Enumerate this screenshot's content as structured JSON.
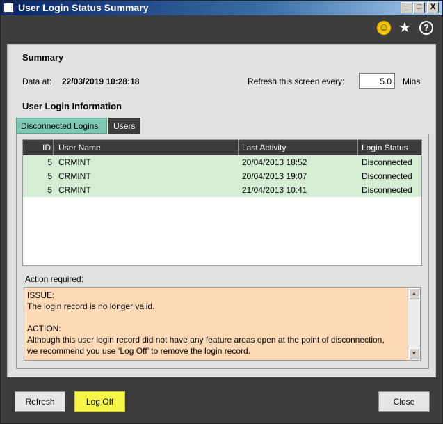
{
  "window": {
    "title": "User Login Status Summary",
    "controls": {
      "minimize": "_",
      "maximize": "□",
      "close": "X"
    }
  },
  "toolbar": {
    "icons": [
      "smiley-icon",
      "star-icon",
      "help-icon"
    ],
    "smiley": "☺",
    "star": "★",
    "help": "?"
  },
  "summary": {
    "heading": "Summary",
    "data_at_label": "Data at:",
    "data_at_value": "22/03/2019 10:28:18",
    "refresh_label": "Refresh this screen every:",
    "refresh_value": "5.0",
    "refresh_unit": "Mins"
  },
  "login_info": {
    "heading": "User Login Information",
    "tabs": [
      {
        "label": "Disconnected Logins",
        "active": true
      },
      {
        "label": "Users",
        "active": false
      }
    ],
    "columns": [
      "ID",
      "User Name",
      "Last Activity",
      "Login Status"
    ],
    "rows": [
      {
        "id": "5",
        "user": "CRMINT",
        "last_activity": "20/04/2013 18:52",
        "status": "Disconnected"
      },
      {
        "id": "5",
        "user": "CRMINT",
        "last_activity": "20/04/2013 19:07",
        "status": "Disconnected"
      },
      {
        "id": "5",
        "user": "CRMINT",
        "last_activity": "21/04/2013 10:41",
        "status": "Disconnected"
      }
    ]
  },
  "action": {
    "label": "Action required:",
    "text": "ISSUE:\nThe login record is no longer valid.\n\nACTION:\nAlthough this user login record did not have any feature areas open at the point of disconnection,\nwe recommend you use ‘Log Off’ to remove the login record."
  },
  "buttons": {
    "refresh": "Refresh",
    "log_off": "Log Off",
    "close": "Close"
  },
  "colors": {
    "title_gradient_start": "#0a246a",
    "active_tab": "#7fc8b4",
    "row_highlight": "#d4edd4",
    "action_background": "#fdd9b5",
    "log_off_highlight": "#f6f64a"
  }
}
